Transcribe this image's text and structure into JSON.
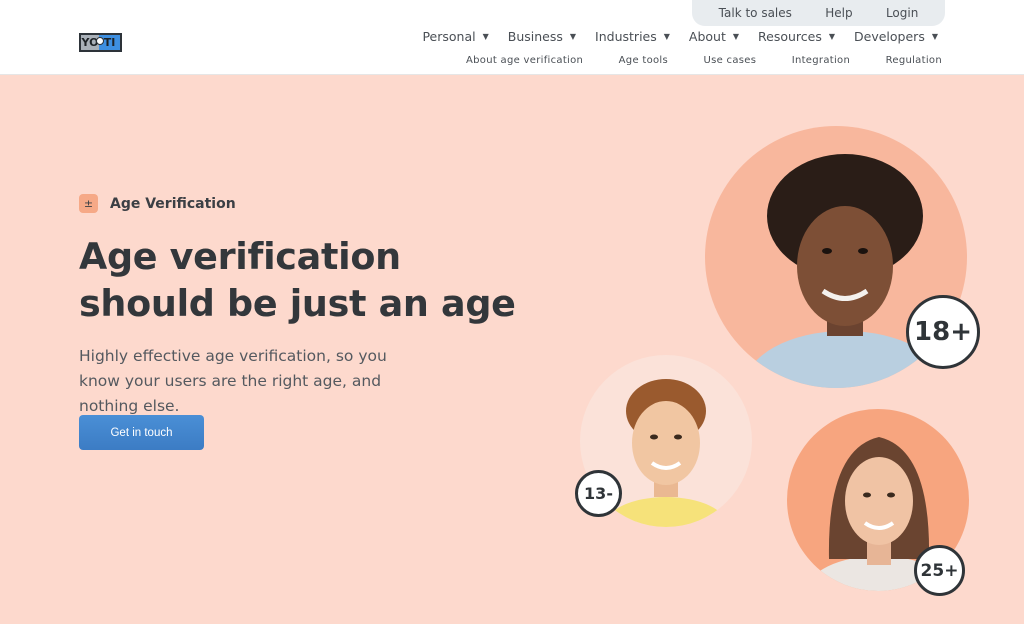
{
  "utility_nav": {
    "talk_to_sales": "Talk to sales",
    "help": "Help",
    "login": "Login"
  },
  "logo": {
    "left": "YO",
    "right": "TI"
  },
  "main_nav": {
    "items": [
      {
        "label": "Personal"
      },
      {
        "label": "Business"
      },
      {
        "label": "Industries"
      },
      {
        "label": "About"
      },
      {
        "label": "Resources"
      },
      {
        "label": "Developers"
      }
    ]
  },
  "sub_nav": {
    "items": [
      {
        "label": "About age verification"
      },
      {
        "label": "Age tools"
      },
      {
        "label": "Use cases"
      },
      {
        "label": "Integration"
      },
      {
        "label": "Regulation"
      }
    ]
  },
  "hero": {
    "badge_icon": "±",
    "badge_label": "Age Verification",
    "title": "Age verification should be just an age",
    "subtitle": "Highly effective age verification, so you know your users are the right age, and nothing else.",
    "cta_label": "Get in touch"
  },
  "age_badges": {
    "adult": "18+",
    "child": "13-",
    "woman": "25+"
  },
  "icons": {
    "caret": "chevron-down-icon",
    "badge": "plus-minus-icon"
  },
  "colors": {
    "hero_bg": "#fdd9cd",
    "cta_blue": "#3c7cc4",
    "accent_peach": "#f6a987"
  }
}
